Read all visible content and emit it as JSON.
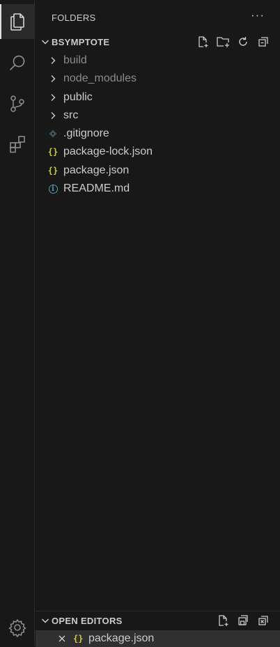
{
  "activity_bar": {
    "items": [
      {
        "name": "explorer",
        "icon": "files-icon",
        "active": true
      },
      {
        "name": "search",
        "icon": "search-icon"
      },
      {
        "name": "source-control",
        "icon": "source-control-icon"
      },
      {
        "name": "extensions",
        "icon": "extensions-icon"
      }
    ],
    "bottom": [
      {
        "name": "settings",
        "icon": "gear-icon"
      }
    ]
  },
  "sidebar": {
    "title": "FOLDERS",
    "more_label": "···",
    "workspace": {
      "name": "BSYMPTOTE",
      "actions": [
        "new-file-icon",
        "new-folder-icon",
        "refresh-icon",
        "collapse-all-icon"
      ],
      "items": [
        {
          "label": "build",
          "type": "folder",
          "dimmed": true
        },
        {
          "label": "node_modules",
          "type": "folder",
          "dimmed": true
        },
        {
          "label": "public",
          "type": "folder"
        },
        {
          "label": "src",
          "type": "folder"
        },
        {
          "label": ".gitignore",
          "type": "git-file"
        },
        {
          "label": "package-lock.json",
          "type": "json-file"
        },
        {
          "label": "package.json",
          "type": "json-file"
        },
        {
          "label": "README.md",
          "type": "info-file"
        }
      ]
    },
    "open_editors": {
      "title": "OPEN EDITORS",
      "actions": [
        "new-untitled-file-icon",
        "save-all-icon",
        "close-all-icon"
      ],
      "items": [
        {
          "label": "package.json",
          "type": "json-file"
        }
      ]
    }
  },
  "colors": {
    "background": "#181818",
    "text": "#cccccc",
    "dimmed_text": "#8b8b8b",
    "json_icon": "#cbcb41",
    "info_icon": "#519aba",
    "git_icon": "#41535b",
    "selected_row": "#303030"
  }
}
